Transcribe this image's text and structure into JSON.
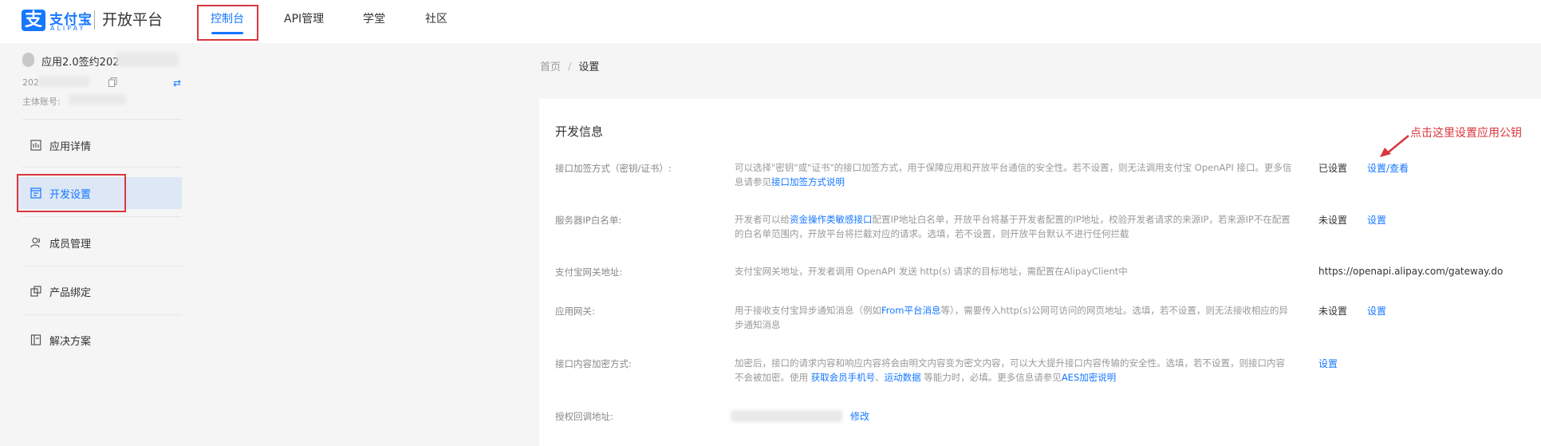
{
  "header": {
    "logo_glyph": "支",
    "logo_cn": "支付宝",
    "logo_en": "ALIPAY",
    "platform": "开放平台",
    "nav": [
      {
        "label": "控制台",
        "active": true
      },
      {
        "label": "API管理"
      },
      {
        "label": "学堂"
      },
      {
        "label": "社区"
      }
    ]
  },
  "sidebar": {
    "app_name": "应用2.0签约202",
    "app_id_prefix": "202",
    "account_label": "主体账号:",
    "menu": [
      {
        "label": "应用详情",
        "icon": "app-detail-icon"
      },
      {
        "label": "开发设置",
        "icon": "dev-settings-icon",
        "active": true
      },
      {
        "label": "成员管理",
        "icon": "members-icon"
      },
      {
        "label": "产品绑定",
        "icon": "product-bind-icon"
      },
      {
        "label": "解决方案",
        "icon": "solution-icon"
      }
    ]
  },
  "breadcrumb": {
    "home": "首页",
    "separator": "/",
    "current": "设置"
  },
  "panel": {
    "title": "开发信息",
    "annotation": "点击这里设置应用公钥",
    "rows": [
      {
        "label": "接口加签方式（密钥/证书）:",
        "desc_text": "可以选择\"密钥\"或\"证书\"的接口加签方式，用于保障应用和开放平台通信的安全性。若不设置，则无法调用支付宝 OpenAPI 接口。更多信息请参见",
        "desc_link": "接口加签方式说明",
        "status": "已设置",
        "action": "设置/查看"
      },
      {
        "label": "服务器IP白名单:",
        "desc_pre": "开发者可以给",
        "desc_link": "资金操作类敏感接口",
        "desc_post": "配置IP地址白名单，开放平台将基于开发者配置的IP地址，校验开发者请求的来源IP，若来源IP不在配置的白名单范围内，开放平台将拦截对应的请求。选填，若不设置，则开放平台默认不进行任何拦截",
        "status": "未设置",
        "action": "设置"
      },
      {
        "label": "支付宝网关地址:",
        "desc_text": "支付宝网关地址，开发者调用 OpenAPI 发送 http(s) 请求的目标地址，需配置在AlipayClient中",
        "value": "https://openapi.alipay.com/gateway.do"
      },
      {
        "label": "应用网关:",
        "desc_pre": "用于接收支付宝异步通知消息（例如",
        "desc_link": "From平台消息",
        "desc_post": "等），需要传入http(s)公网可访问的网页地址。选填，若不设置，则无法接收相应的异步通知消息",
        "status": "未设置",
        "action": "设置"
      },
      {
        "label": "接口内容加密方式:",
        "desc_pre": "加密后，接口的请求内容和响应内容将会由明文内容变为密文内容，可以大大提升接口内容传输的安全性。选填，若不设置，则接口内容不会被加密。使用 ",
        "desc_link1": "获取会员手机号",
        "desc_mid": "、",
        "desc_link2": "运动数据",
        "desc_mid2": " 等能力时，必填。更多信息请参见",
        "desc_link3": "AES加密说明",
        "action": "设置"
      },
      {
        "label": "授权回调地址:",
        "action": "修改"
      }
    ]
  },
  "colors": {
    "accent": "#1677ff",
    "highlight": "#d9363e",
    "active_bg": "#dde7f6"
  }
}
